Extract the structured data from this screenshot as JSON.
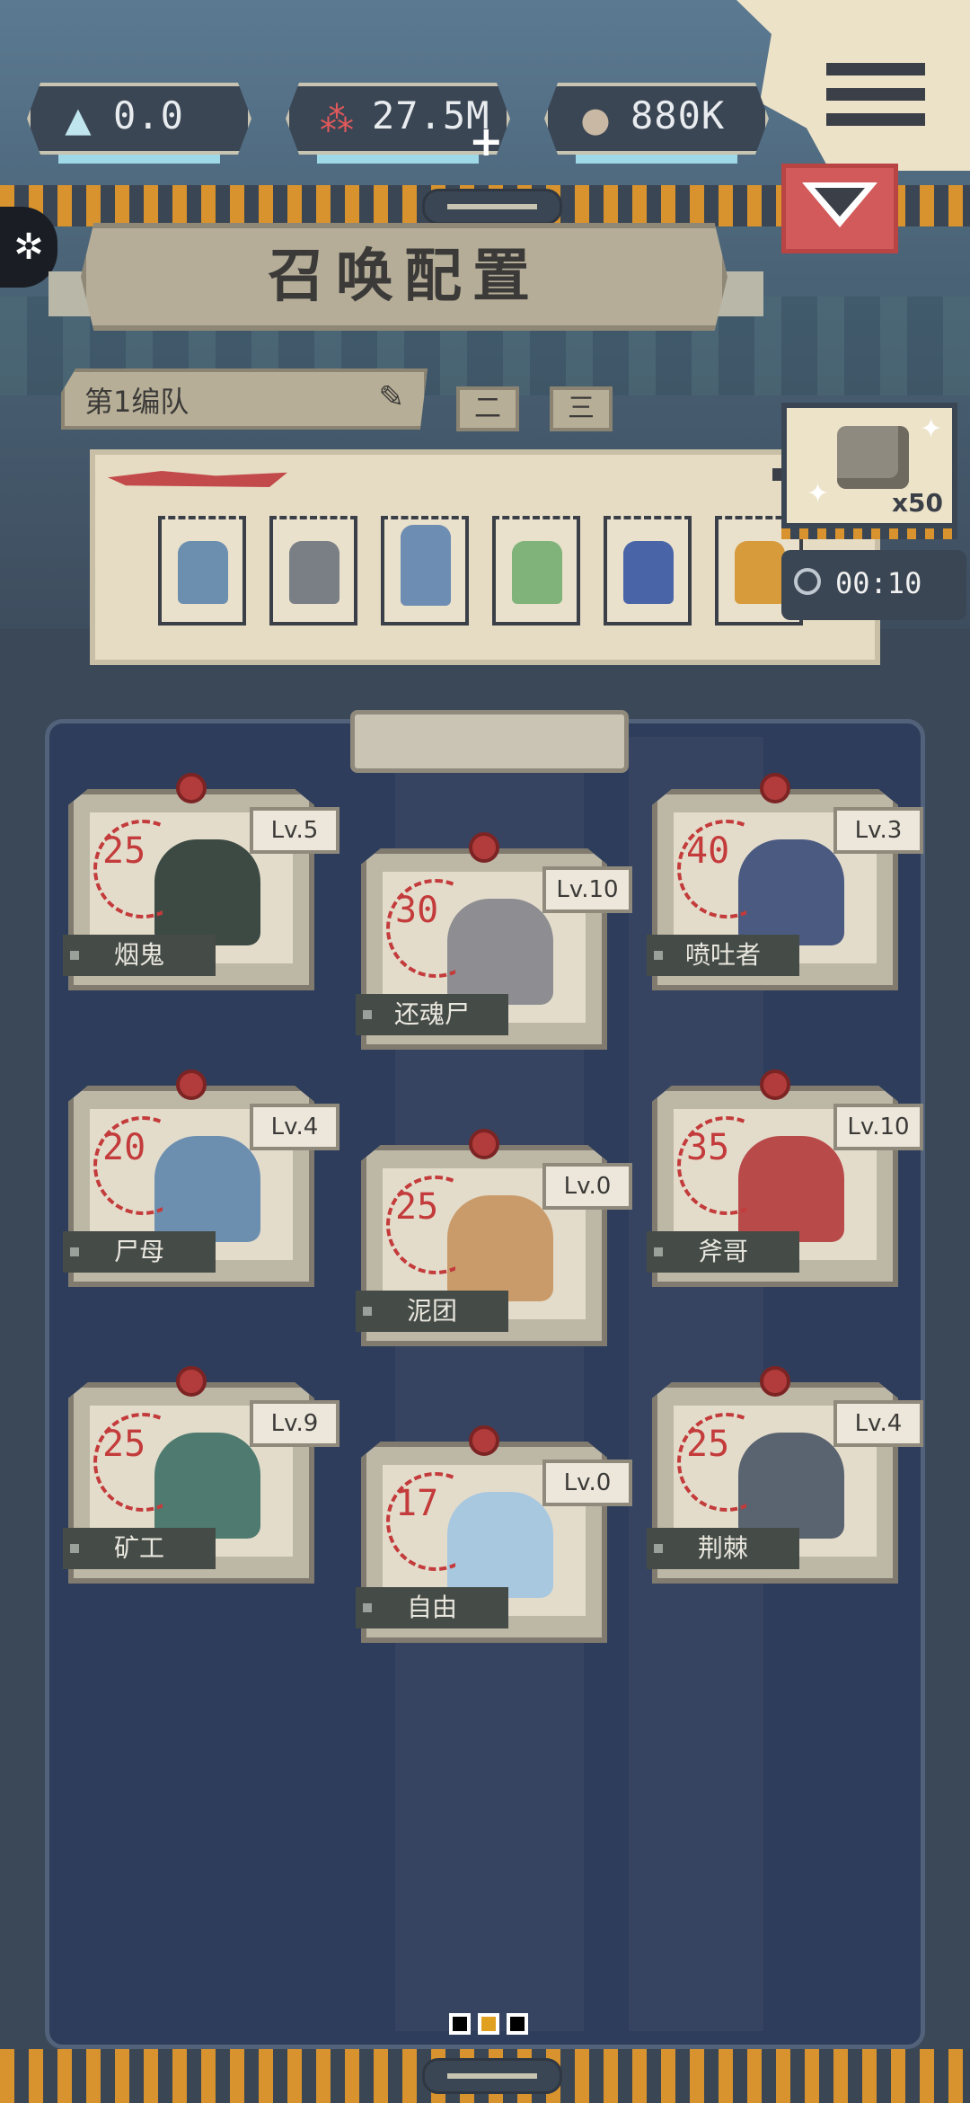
{
  "resources": {
    "crystal": {
      "value": "0.0",
      "icon": "crystal-icon"
    },
    "blood": {
      "value": "27.5M",
      "icon": "blood-drops-icon"
    },
    "stone": {
      "value": "880K",
      "icon": "stone-icon"
    }
  },
  "header": {
    "title": "召唤配置"
  },
  "team": {
    "label": "第1编队",
    "tabs": [
      "二",
      "三"
    ]
  },
  "reward": {
    "multiplier": "x50",
    "timer": "00:10"
  },
  "cards": [
    {
      "name": "烟鬼",
      "cost": "25",
      "level": "Lv.5"
    },
    {
      "name": "还魂尸",
      "cost": "30",
      "level": "Lv.10"
    },
    {
      "name": "喷吐者",
      "cost": "40",
      "level": "Lv.3"
    },
    {
      "name": "尸母",
      "cost": "20",
      "level": "Lv.4"
    },
    {
      "name": "泥团",
      "cost": "25",
      "level": "Lv.0"
    },
    {
      "name": "斧哥",
      "cost": "35",
      "level": "Lv.10"
    },
    {
      "name": "矿工",
      "cost": "25",
      "level": "Lv.9"
    },
    {
      "name": "自由",
      "cost": "17",
      "level": "Lv.0"
    },
    {
      "name": "荆棘",
      "cost": "25",
      "level": "Lv.4"
    }
  ],
  "pager": {
    "pages": 3,
    "current": 2
  }
}
